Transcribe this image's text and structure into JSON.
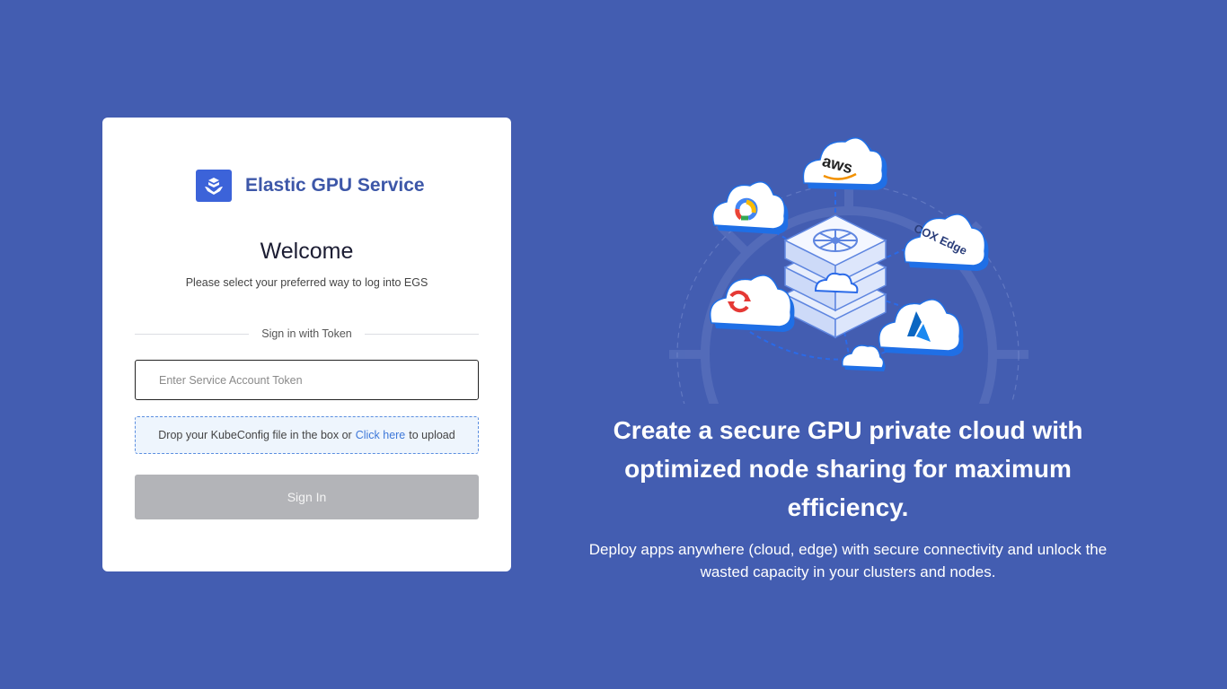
{
  "brand": {
    "name": "Elastic GPU Service",
    "logo_icon": "egs-logo-icon"
  },
  "login": {
    "title": "Welcome",
    "subtitle": "Please select your preferred way to log into EGS",
    "divider_text": "Sign in with Token",
    "token_placeholder": "Enter Service Account Token",
    "token_value": "",
    "dropzone_prefix": "Drop your KubeConfig file in the box or",
    "dropzone_link": "Click here",
    "dropzone_suffix": "to upload",
    "signin_label": "Sign In"
  },
  "hero": {
    "headline": "Create a secure GPU private cloud with optimized node sharing for maximum efficiency.",
    "description": "Deploy apps anywhere (cloud, edge) with secure connectivity and unlock the wasted capacity in your clusters and nodes.",
    "cloud_labels": {
      "aws": "aws",
      "cox": "COX Edge"
    }
  },
  "colors": {
    "background": "#435db1",
    "brand_text": "#3d57a8",
    "logo_bg": "#3c63d9",
    "link": "#3e78d9",
    "button_disabled": "#b3b4b8",
    "dropzone_bg": "#eef5fd",
    "dropzone_border": "#5b8ee0",
    "cloud_blue": "#1f6fe6"
  }
}
